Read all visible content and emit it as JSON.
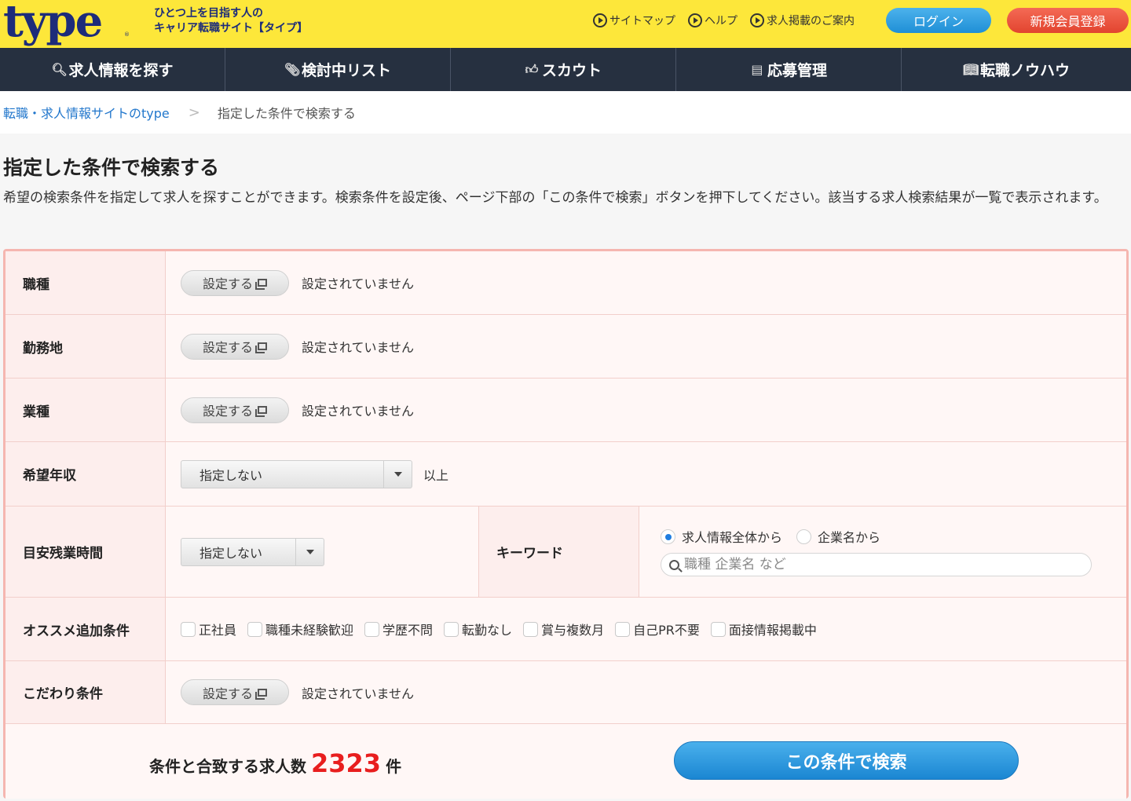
{
  "header": {
    "logo_text": "type",
    "logo_mark": "®",
    "tagline_line1": "ひとつ上を目指す人の",
    "tagline_line2": "キャリア転職サイト【タイプ】",
    "links": [
      "サイトマップ",
      "ヘルプ",
      "求人掲載のご案内"
    ],
    "login_label": "ログイン",
    "register_label": "新規会員登録"
  },
  "nav": {
    "items": [
      {
        "label": "求人情報を探す",
        "icon": "search-icon"
      },
      {
        "label": "検討中リスト",
        "icon": "paperclip-icon"
      },
      {
        "label": "スカウト",
        "icon": "thumbs-up-icon"
      },
      {
        "label": "応募管理",
        "icon": "document-icon"
      },
      {
        "label": "転職ノウハウ",
        "icon": "book-icon"
      }
    ]
  },
  "breadcrumb": {
    "home": "転職・求人情報サイトのtype",
    "separator": ">",
    "current": "指定した条件で検索する"
  },
  "page": {
    "title": "指定した条件で検索する",
    "intro": "希望の検索条件を指定して求人を探すことができます。検索条件を設定後、ページ下部の「この条件で検索」ボタンを押下してください。該当する求人検索結果が一覧で表示されます。"
  },
  "form": {
    "set_label": "設定する",
    "unset_text": "設定されていません",
    "job_type_label": "職種",
    "location_label": "勤務地",
    "industry_label": "業種",
    "salary_label": "希望年収",
    "salary_value": "指定しない",
    "salary_suffix": "以上",
    "overtime_label": "目安残業時間",
    "overtime_value": "指定しない",
    "keyword_label": "キーワード",
    "keyword_radio_all": "求人情報全体から",
    "keyword_radio_company": "企業名から",
    "keyword_placeholder": "職種 企業名 など",
    "recommend_label": "オススメ追加条件",
    "recommend_options": [
      "正社員",
      "職種未経験歓迎",
      "学歴不問",
      "転勤なし",
      "賞与複数月",
      "自己PR不要",
      "面接情報掲載中"
    ],
    "special_label": "こだわり条件",
    "count_prefix": "条件と合致する求人数",
    "count_value": "2323",
    "count_suffix": "件",
    "submit_label": "この条件で検索"
  }
}
